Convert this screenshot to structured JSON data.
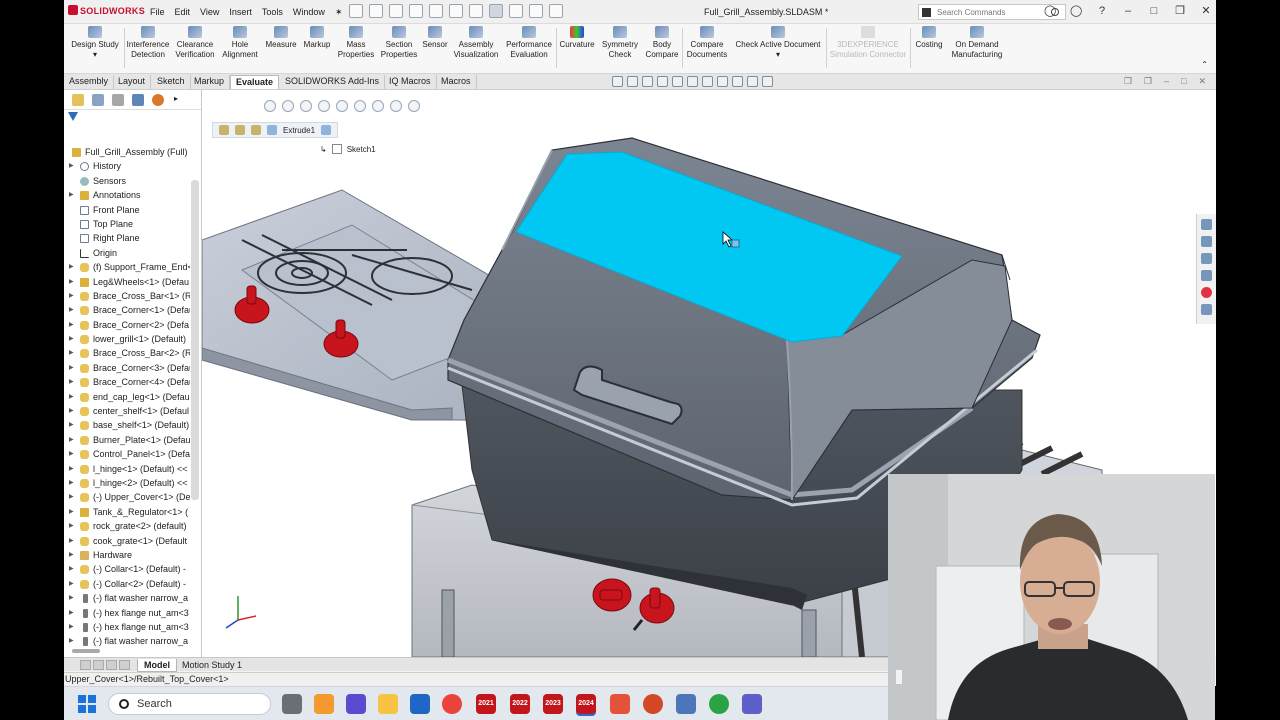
{
  "app": {
    "logo": "SOLIDWORKS",
    "document_title": "Full_Grill_Assembly.SLDASM *"
  },
  "menus": [
    "File",
    "Edit",
    "View",
    "Insert",
    "Tools",
    "Window"
  ],
  "command_search": {
    "placeholder": "Search Commands"
  },
  "ribbon": [
    {
      "label": "Design Study",
      "icon": "design-study-icon"
    },
    {
      "label": "Interference Detection",
      "icon": "interference-icon"
    },
    {
      "label": "Clearance Verification",
      "icon": "clearance-icon"
    },
    {
      "label": "Hole Alignment",
      "icon": "hole-alignment-icon"
    },
    {
      "label": "Measure",
      "icon": "measure-icon"
    },
    {
      "label": "Markup",
      "icon": "markup-icon"
    },
    {
      "label": "Mass Properties",
      "icon": "mass-properties-icon"
    },
    {
      "label": "Section Properties",
      "icon": "section-properties-icon"
    },
    {
      "label": "Sensor",
      "icon": "sensor-icon"
    },
    {
      "label": "Assembly Visualization",
      "icon": "assembly-visualization-icon"
    },
    {
      "label": "Performance Evaluation",
      "icon": "performance-icon"
    },
    {
      "label": "Curvature",
      "icon": "curvature-icon"
    },
    {
      "label": "Symmetry Check",
      "icon": "symmetry-icon"
    },
    {
      "label": "Body Compare",
      "icon": "body-compare-icon"
    },
    {
      "label": "Compare Documents",
      "icon": "compare-docs-icon"
    },
    {
      "label": "Check Active Document",
      "icon": "check-doc-icon"
    },
    {
      "label": "3DEXPERIENCE Simulation Connector",
      "icon": "3dx-icon",
      "disabled": true
    },
    {
      "label": "Costing",
      "icon": "costing-icon"
    },
    {
      "label": "On Demand Manufacturing",
      "icon": "manufacturing-icon"
    }
  ],
  "command_tabs": [
    "Assembly",
    "Layout",
    "Sketch",
    "Markup",
    "Evaluate",
    "SOLIDWORKS Add-Ins",
    "IQ Macros",
    "Macros"
  ],
  "active_command_tab": "Evaluate",
  "breadcrumb": {
    "feature": "Extrude1",
    "sketch": "Sketch1"
  },
  "feature_tree": [
    {
      "label": "Full_Grill_Assembly (Full) <D",
      "type": "asm",
      "twisty": false,
      "root": true
    },
    {
      "label": "History",
      "type": "hist",
      "twisty": true
    },
    {
      "label": "Sensors",
      "type": "sens",
      "twisty": false
    },
    {
      "label": "Annotations",
      "type": "anno",
      "twisty": true
    },
    {
      "label": "Front Plane",
      "type": "plane",
      "twisty": false
    },
    {
      "label": "Top Plane",
      "type": "plane",
      "twisty": false
    },
    {
      "label": "Right Plane",
      "type": "plane",
      "twisty": false
    },
    {
      "label": "Origin",
      "type": "origin",
      "twisty": false
    },
    {
      "label": "(f) Support_Frame_End<",
      "type": "part",
      "twisty": true
    },
    {
      "label": "Leg&Wheels<1> (Defau",
      "type": "asm",
      "twisty": true
    },
    {
      "label": "Brace_Cross_Bar<1> (Re",
      "type": "part",
      "twisty": true
    },
    {
      "label": "Brace_Corner<1> (Defau",
      "type": "part",
      "twisty": true
    },
    {
      "label": "Brace_Corner<2> (Defa",
      "type": "part",
      "twisty": true
    },
    {
      "label": "lower_grill<1> (Default)",
      "type": "part",
      "twisty": true
    },
    {
      "label": "Brace_Cross_Bar<2> (Re",
      "type": "part",
      "twisty": true
    },
    {
      "label": "Brace_Corner<3> (Defau",
      "type": "part",
      "twisty": true
    },
    {
      "label": "Brace_Corner<4> (Defau",
      "type": "part",
      "twisty": true
    },
    {
      "label": "end_cap_leg<1> (Defau",
      "type": "part",
      "twisty": true
    },
    {
      "label": "center_shelf<1> (Defaul",
      "type": "part",
      "twisty": true
    },
    {
      "label": "base_shelf<1> (Default)",
      "type": "part",
      "twisty": true
    },
    {
      "label": "Burner_Plate<1> (Defau",
      "type": "part",
      "twisty": true
    },
    {
      "label": "Control_Panel<1> (Defa",
      "type": "part",
      "twisty": true
    },
    {
      "label": "l_hinge<1> (Default) <<",
      "type": "part",
      "twisty": true
    },
    {
      "label": "l_hinge<2> (Default) <<",
      "type": "part",
      "twisty": true
    },
    {
      "label": "(-) Upper_Cover<1> (De",
      "type": "part",
      "twisty": true
    },
    {
      "label": "Tank_&_Regulator<1> (",
      "type": "asm",
      "twisty": true
    },
    {
      "label": "rock_grate<2> (default)",
      "type": "part",
      "twisty": true
    },
    {
      "label": "cook_grate<1> (Default",
      "type": "part",
      "twisty": true
    },
    {
      "label": "Hardware",
      "type": "folder",
      "twisty": true
    },
    {
      "label": "(-) Collar<1> (Default) -",
      "type": "part",
      "twisty": true
    },
    {
      "label": "(-) Collar<2> (Default) -",
      "type": "part",
      "twisty": true
    },
    {
      "label": "(-) flat washer narrow_a",
      "type": "hw",
      "twisty": true
    },
    {
      "label": "(-) hex flange nut_am<3",
      "type": "hw",
      "twisty": true
    },
    {
      "label": "(-) hex flange nut_am<3",
      "type": "hw",
      "twisty": true
    },
    {
      "label": "(-) flat washer narrow_a",
      "type": "hw",
      "twisty": true
    }
  ],
  "bottom_tabs": [
    "Model",
    "Motion Study 1"
  ],
  "active_bottom_tab": "Model",
  "status_text": "Upper_Cover<1>/Rebuilt_Top_Cover<1>",
  "taskbar": {
    "search_placeholder": "Search",
    "sw_versions": [
      "2021",
      "2022",
      "2023",
      "2024"
    ]
  },
  "colors": {
    "selection_highlight": "#00c8f2",
    "grill_body": "#727a86",
    "knob_red": "#c8141c"
  }
}
